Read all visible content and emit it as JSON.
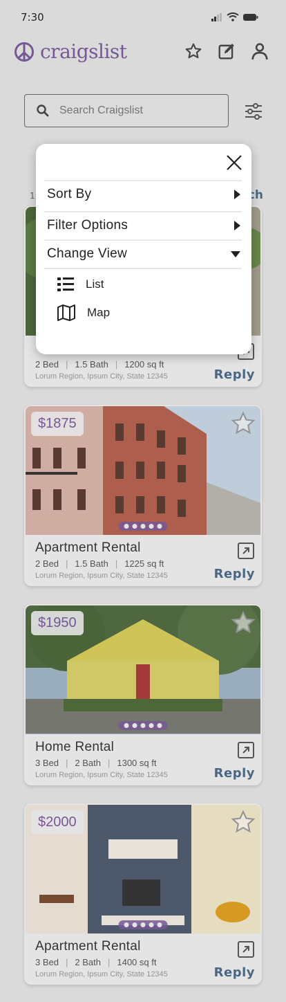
{
  "status": {
    "time": "7:30"
  },
  "brand": {
    "name": "craigslist",
    "color": "#7a5a9a"
  },
  "header": {
    "icons": [
      "star-icon",
      "compose-icon",
      "profile-icon"
    ]
  },
  "search": {
    "placeholder": "Search Craigslist"
  },
  "peek": {
    "count_prefix": "1,",
    "search_suffix": "ch"
  },
  "menu": {
    "sort_by": "Sort By",
    "filter_options": "Filter Options",
    "change_view": "Change View",
    "views": [
      {
        "label": "List",
        "icon": "list-icon"
      },
      {
        "label": "Map",
        "icon": "map-icon"
      }
    ]
  },
  "listings": [
    {
      "price": "",
      "title": "",
      "beds": "2 Bed",
      "baths": "1.5 Bath",
      "sqft": "1200 sq ft",
      "location": "Lorum Region, Ipsum City, State 12345",
      "reply": "Reply"
    },
    {
      "price": "$1875",
      "title": "Apartment Rental",
      "beds": "2 Bed",
      "baths": "1.5 Bath",
      "sqft": "1225 sq ft",
      "location": "Lorum Region, Ipsum City, State 12345",
      "reply": "Reply"
    },
    {
      "price": "$1950",
      "title": "Home Rental",
      "beds": "3 Bed",
      "baths": "2 Bath",
      "sqft": "1300 sq ft",
      "location": "Lorum Region, Ipsum City, State 12345",
      "reply": "Reply"
    },
    {
      "price": "$2000",
      "title": "Apartment Rental",
      "beds": "3 Bed",
      "baths": "2 Bath",
      "sqft": "1400 sq ft",
      "location": "Lorum Region, Ipsum City, State 12345",
      "reply": "Reply"
    }
  ]
}
